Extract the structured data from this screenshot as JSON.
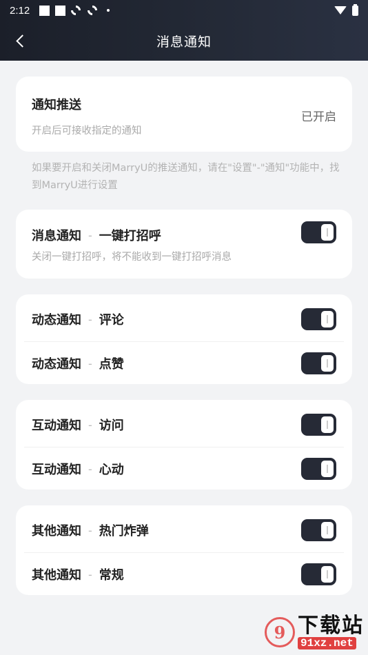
{
  "status_bar": {
    "time": "2:12"
  },
  "header": {
    "title": "消息通知"
  },
  "push": {
    "title": "通知推送",
    "subtitle": "开启后可接收指定的通知",
    "status": "已开启"
  },
  "hint": "如果要开启和关闭MarryU的推送通知，请在\"设置\"-\"通知\"功能中，找到MarryU进行设置",
  "separator": "-",
  "greet": {
    "category": "消息通知",
    "name": "一键打招呼",
    "desc": "关闭一键打招呼，将不能收到一键打招呼消息",
    "on": true
  },
  "groups": [
    {
      "items": [
        {
          "category": "动态通知",
          "name": "评论",
          "on": true
        },
        {
          "category": "动态通知",
          "name": "点赞",
          "on": true
        }
      ]
    },
    {
      "items": [
        {
          "category": "互动通知",
          "name": "访问",
          "on": true
        },
        {
          "category": "互动通知",
          "name": "心动",
          "on": true
        }
      ]
    },
    {
      "items": [
        {
          "category": "其他通知",
          "name": "热门炸弹",
          "on": true
        },
        {
          "category": "其他通知",
          "name": "常规",
          "on": true
        }
      ]
    }
  ],
  "watermark": {
    "main": "下载站",
    "url": "91xz.net",
    "logo": "9"
  },
  "colors": {
    "header": "#1b1f29",
    "toggle_on": "#262a36",
    "background": "#f2f3f5"
  }
}
